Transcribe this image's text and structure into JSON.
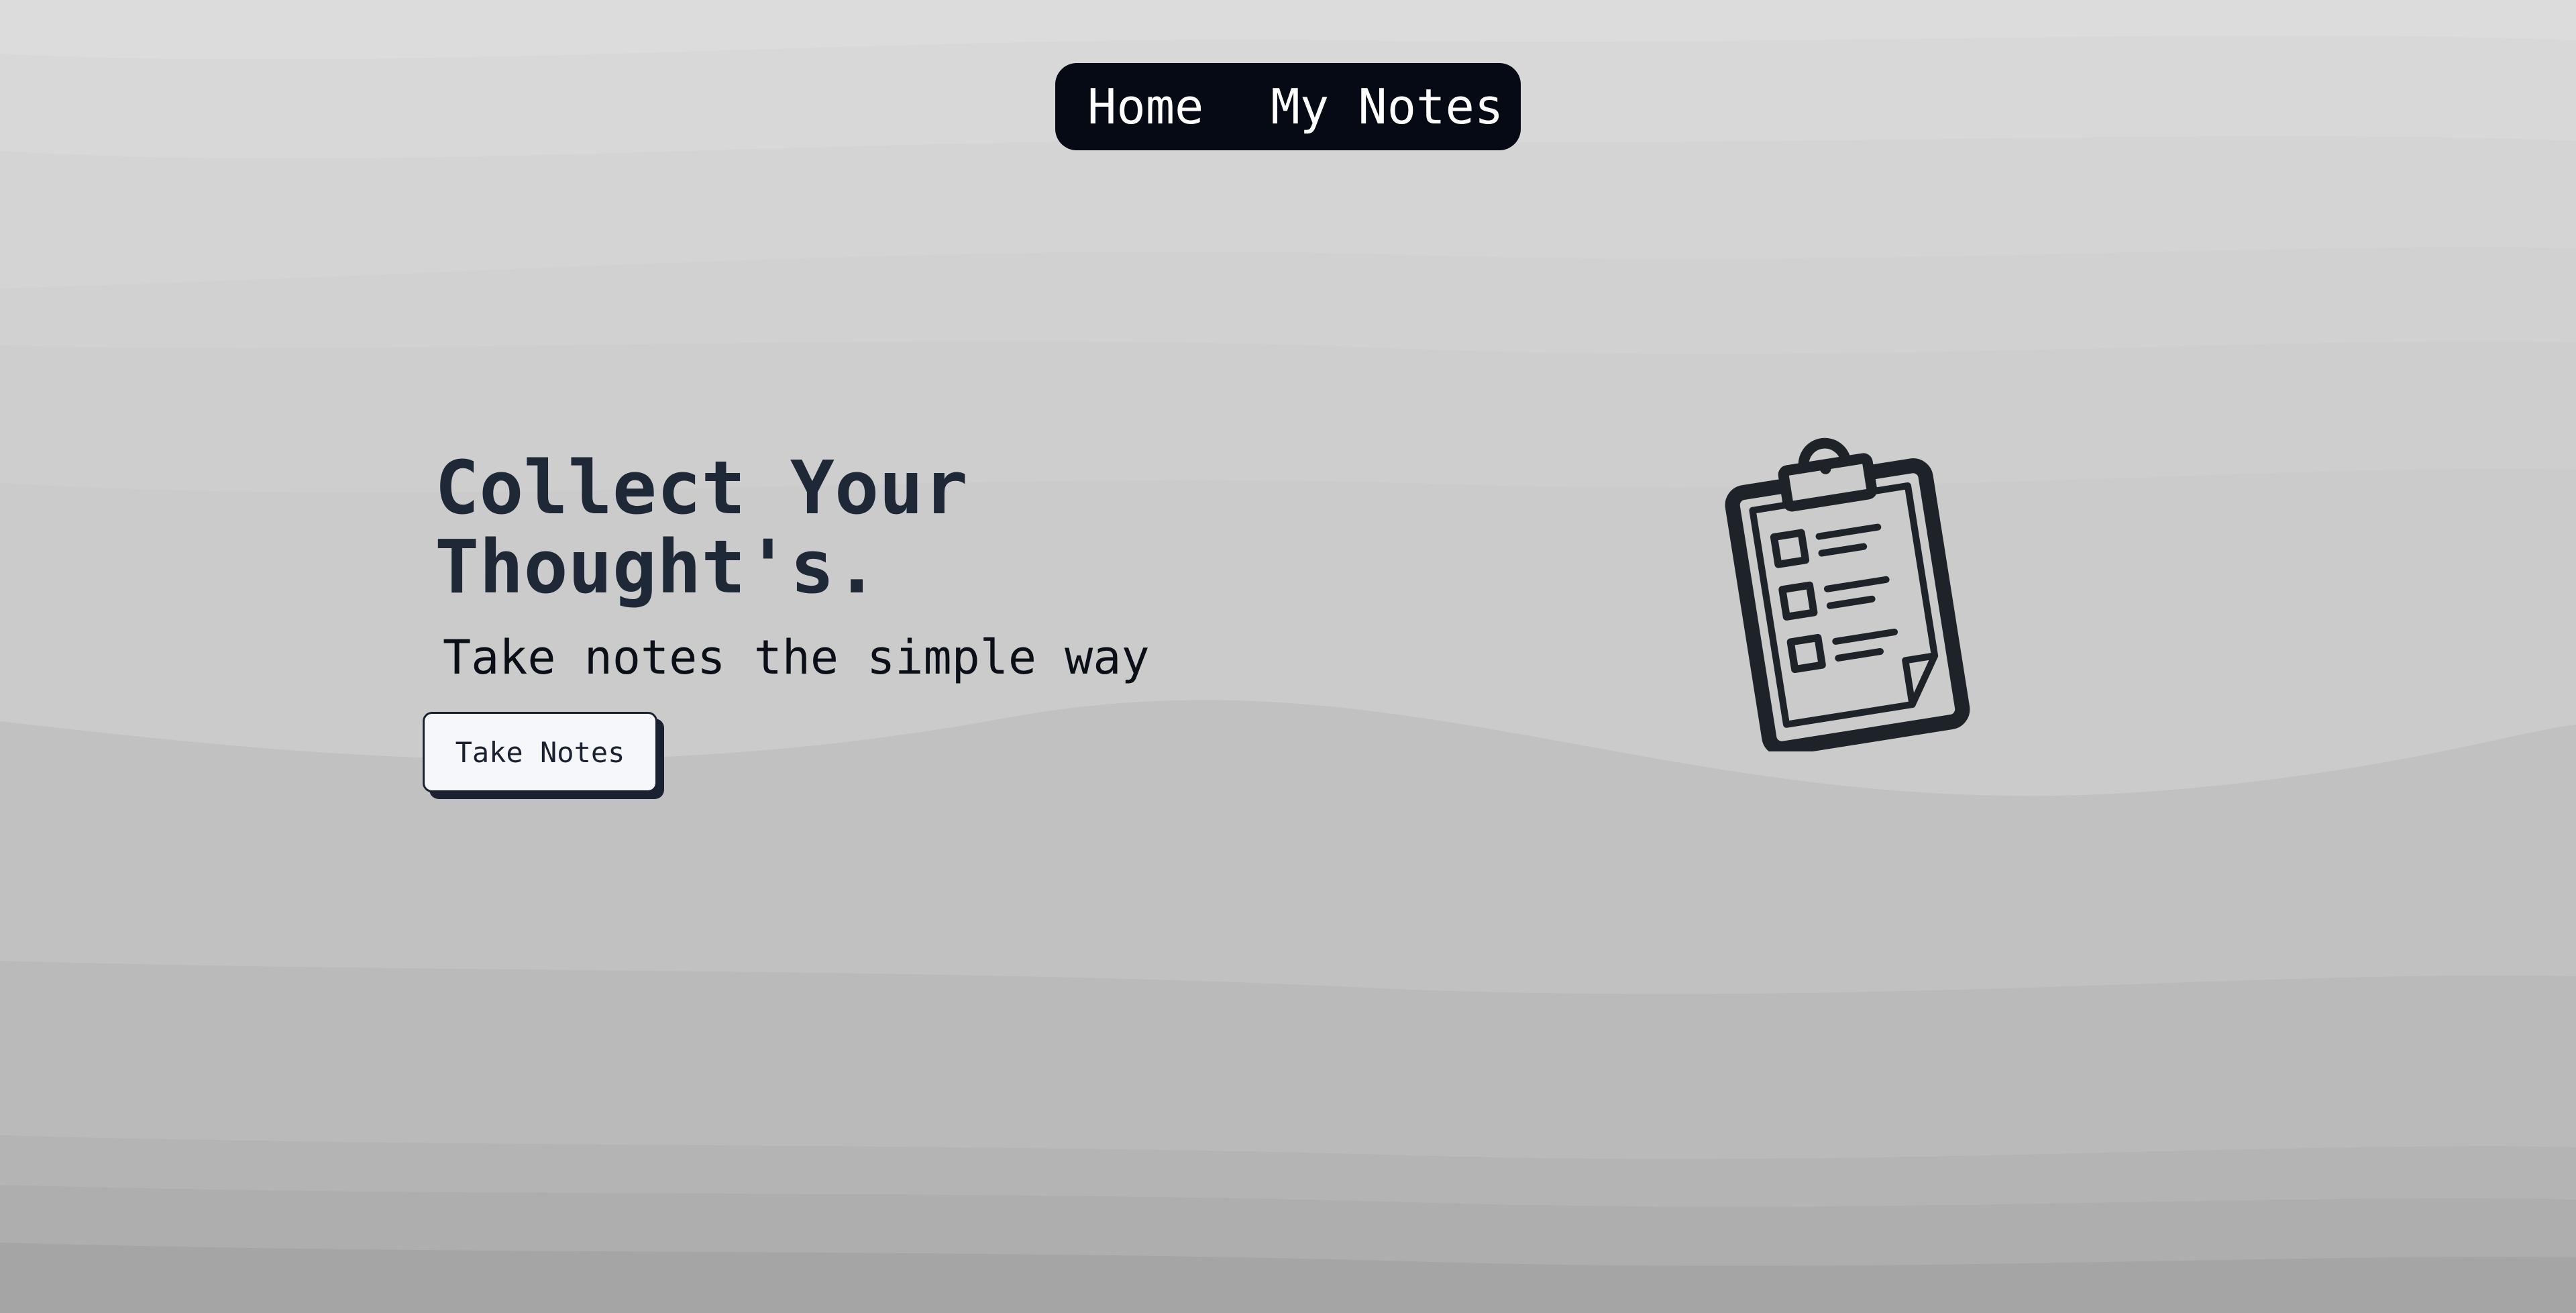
{
  "nav": {
    "home_label": "Home",
    "notes_label": "My Notes"
  },
  "hero": {
    "title": "Collect Your\nThought's.",
    "subtitle": "Take notes the simple way",
    "cta_label": "Take Notes"
  },
  "illustration": {
    "icon": "clipboard-checklist-icon"
  },
  "colors": {
    "nav_background": "#050a14",
    "title": "#1e2836",
    "button_background": "#f6f7fb",
    "button_border": "#1a2130",
    "icon_stroke": "#1e2329",
    "wave_light": "#dcdcdc",
    "wave_dark": "#a4a4a4"
  }
}
